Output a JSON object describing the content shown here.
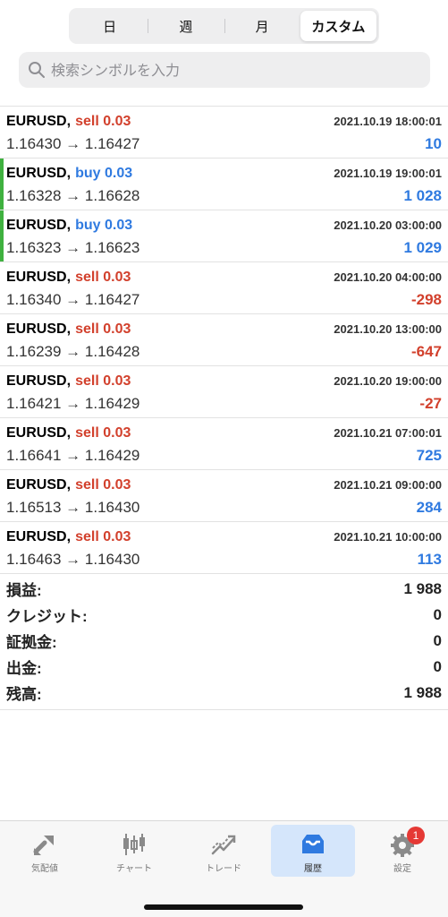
{
  "period_tabs": [
    "日",
    "週",
    "月",
    "カスタム"
  ],
  "active_period": "カスタム",
  "search": {
    "placeholder": "検索シンボルを入力"
  },
  "trades": [
    {
      "symbol": "EURUSD,",
      "side": "sell 0.03",
      "type": "sell",
      "time": "2021.10.19 18:00:01",
      "prices": "1.16430 → 1.16427",
      "profit": "10",
      "profit_sign": "pos"
    },
    {
      "symbol": "EURUSD,",
      "side": "buy 0.03",
      "type": "buy",
      "time": "2021.10.19 19:00:01",
      "prices": "1.16328 → 1.16628",
      "profit": "1 028",
      "profit_sign": "pos"
    },
    {
      "symbol": "EURUSD,",
      "side": "buy 0.03",
      "type": "buy",
      "time": "2021.10.20 03:00:00",
      "prices": "1.16323 → 1.16623",
      "profit": "1 029",
      "profit_sign": "pos"
    },
    {
      "symbol": "EURUSD,",
      "side": "sell 0.03",
      "type": "sell",
      "time": "2021.10.20 04:00:00",
      "prices": "1.16340 → 1.16427",
      "profit": "-298",
      "profit_sign": "neg"
    },
    {
      "symbol": "EURUSD,",
      "side": "sell 0.03",
      "type": "sell",
      "time": "2021.10.20 13:00:00",
      "prices": "1.16239 → 1.16428",
      "profit": "-647",
      "profit_sign": "neg"
    },
    {
      "symbol": "EURUSD,",
      "side": "sell 0.03",
      "type": "sell",
      "time": "2021.10.20 19:00:00",
      "prices": "1.16421 → 1.16429",
      "profit": "-27",
      "profit_sign": "neg"
    },
    {
      "symbol": "EURUSD,",
      "side": "sell 0.03",
      "type": "sell",
      "time": "2021.10.21 07:00:01",
      "prices": "1.16641 → 1.16429",
      "profit": "725",
      "profit_sign": "pos"
    },
    {
      "symbol": "EURUSD,",
      "side": "sell 0.03",
      "type": "sell",
      "time": "2021.10.21 09:00:00",
      "prices": "1.16513 → 1.16430",
      "profit": "284",
      "profit_sign": "pos"
    },
    {
      "symbol": "EURUSD,",
      "side": "sell 0.03",
      "type": "sell",
      "time": "2021.10.21 10:00:00",
      "prices": "1.16463 → 1.16430",
      "profit": "113",
      "profit_sign": "pos"
    }
  ],
  "summary": [
    {
      "label": "損益:",
      "value": "1 988"
    },
    {
      "label": "クレジット:",
      "value": "0"
    },
    {
      "label": "証拠金:",
      "value": "0"
    },
    {
      "label": "出金:",
      "value": "0"
    },
    {
      "label": "残高:",
      "value": "1 988"
    }
  ],
  "tabbar": [
    {
      "label": "気配値",
      "icon": "quotes-icon"
    },
    {
      "label": "チャート",
      "icon": "chart-icon"
    },
    {
      "label": "トレード",
      "icon": "trade-icon"
    },
    {
      "label": "履歴",
      "icon": "history-icon",
      "active": true
    },
    {
      "label": "設定",
      "icon": "settings-icon",
      "badge": "1"
    }
  ],
  "colors": {
    "sell": "#d2402c",
    "buy": "#2f7ae0",
    "buy_marker": "#3fb13f",
    "active_tab_bg": "#d5e6fb",
    "badge": "#e53935"
  }
}
